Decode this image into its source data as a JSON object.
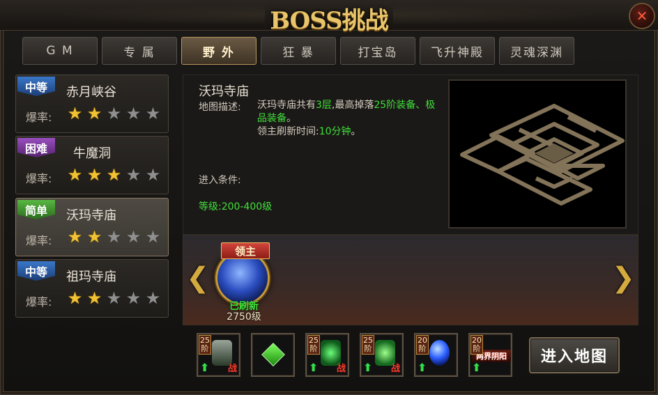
{
  "window": {
    "title": "BOSS挑战",
    "close_icon": "close-icon"
  },
  "tabs": [
    {
      "label": "G M",
      "active": false
    },
    {
      "label": "专 属",
      "active": false
    },
    {
      "label": "野 外",
      "active": true
    },
    {
      "label": "狂 暴",
      "active": false
    },
    {
      "label": "打宝岛",
      "active": false
    },
    {
      "label": "飞升神殿",
      "active": false
    },
    {
      "label": "灵魂深渊",
      "active": false
    }
  ],
  "maps": [
    {
      "difficulty": "中等",
      "name": "赤月峡谷",
      "rate_label": "爆率:",
      "stars": 2,
      "max_stars": 5,
      "color": "#3a77c8",
      "selected": false
    },
    {
      "difficulty": "困难",
      "name": "牛魔洞",
      "rate_label": "爆率:",
      "stars": 3,
      "max_stars": 5,
      "color": "#9a4fc0",
      "selected": false
    },
    {
      "difficulty": "简单",
      "name": "沃玛寺庙",
      "rate_label": "爆率:",
      "stars": 2,
      "max_stars": 5,
      "color": "#58b842",
      "selected": true
    },
    {
      "difficulty": "中等",
      "name": "祖玛寺庙",
      "rate_label": "爆率:",
      "stars": 2,
      "max_stars": 5,
      "color": "#3a77c8",
      "selected": false
    }
  ],
  "detail": {
    "map_name": "沃玛寺庙",
    "desc_label": "地图描述:",
    "desc_p1": "沃玛寺庙共有",
    "desc_floors": "3层",
    "desc_p2": ",最高掉落",
    "desc_drop": "25阶装备、极品装备",
    "desc_p3": "。",
    "refresh_label": "领主刷新时间:",
    "refresh_value": "10分钟",
    "refresh_end": "。",
    "cond_label": "进入条件:",
    "cond_level": "等级:200-400级"
  },
  "boss": {
    "banner": "领主",
    "status": "已刷新",
    "level": "2750级",
    "prev_icon": "chevron-left-icon",
    "next_icon": "chevron-right-icon"
  },
  "drops": [
    {
      "tier": "25阶",
      "art": "armor-icon",
      "up": "⬆",
      "zhan": "战",
      "color": "#6a7a6a"
    },
    {
      "tier": "",
      "art": "emerald-gem-icon",
      "up": "",
      "zhan": "",
      "color": "#3fbf2a"
    },
    {
      "tier": "25阶",
      "art": "necklace-icon",
      "up": "⬆",
      "zhan": "战",
      "color": "#2e9a3a"
    },
    {
      "tier": "25阶",
      "art": "ring-icon",
      "up": "⬆",
      "zhan": "战",
      "color": "#2ea43a"
    },
    {
      "tier": "20阶",
      "art": "blue-orb-icon",
      "up": "⬆",
      "zhan": "",
      "color": "#2a5cff"
    },
    {
      "tier": "20阶",
      "art": "scroll-icon",
      "up": "⬆",
      "zhan": "",
      "color": "#7a2a1a"
    }
  ],
  "drop_6_text": "两界阴阳",
  "enter_button": "进入地图"
}
